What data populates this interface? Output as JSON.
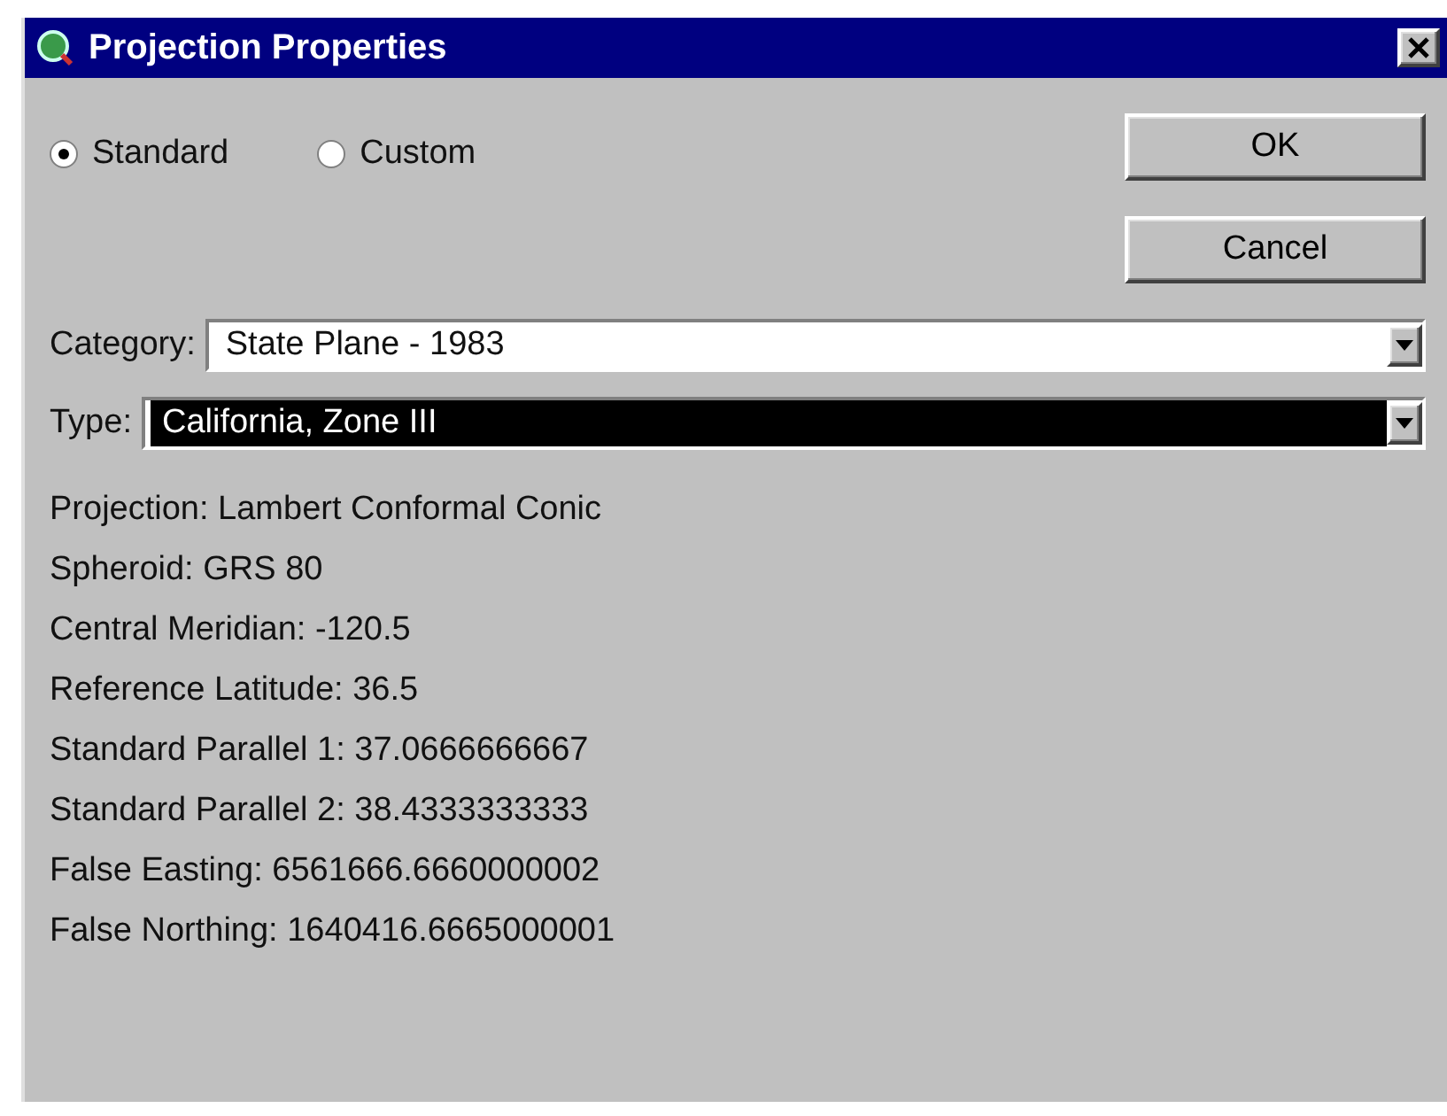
{
  "window": {
    "title": "Projection Properties"
  },
  "radios": [
    {
      "label": "Standard",
      "selected": true
    },
    {
      "label": "Custom",
      "selected": false
    }
  ],
  "buttons": [
    "OK",
    "Cancel"
  ],
  "fields": [
    {
      "label": "Category:",
      "value": "State Plane - 1983",
      "highlighted": false
    },
    {
      "label": "Type:",
      "value": "California, Zone III",
      "highlighted": true
    }
  ],
  "properties": [
    "Projection:  Lambert Conformal Conic",
    "Spheroid:  GRS 80",
    "Central Meridian: -120.5",
    "Reference Latitude: 36.5",
    "Standard Parallel 1: 37.0666666667",
    "Standard Parallel 2: 38.4333333333",
    "False Easting: 6561666.6660000002",
    "False Northing: 1640416.6665000001"
  ]
}
